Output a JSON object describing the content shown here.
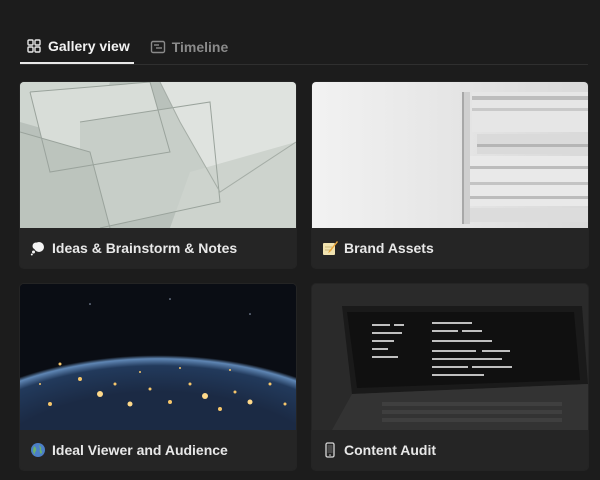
{
  "tabs": [
    {
      "label": "Gallery view",
      "icon": "gallery-grid-icon",
      "active": true
    },
    {
      "label": "Timeline",
      "icon": "timeline-icon",
      "active": false
    }
  ],
  "cards": [
    {
      "title": "Ideas & Brainstorm & Notes",
      "icon": "thought-bubble-icon"
    },
    {
      "title": "Brand Assets",
      "icon": "pencil-paper-icon"
    },
    {
      "title": "Ideal Viewer and Audience",
      "icon": "globe-icon"
    },
    {
      "title": "Content Audit",
      "icon": "mobile-phone-icon"
    }
  ],
  "colors": {
    "background": "#1c1c1c",
    "card": "#252525",
    "text": "#e8e8e8",
    "muted": "#8a8a8a"
  }
}
